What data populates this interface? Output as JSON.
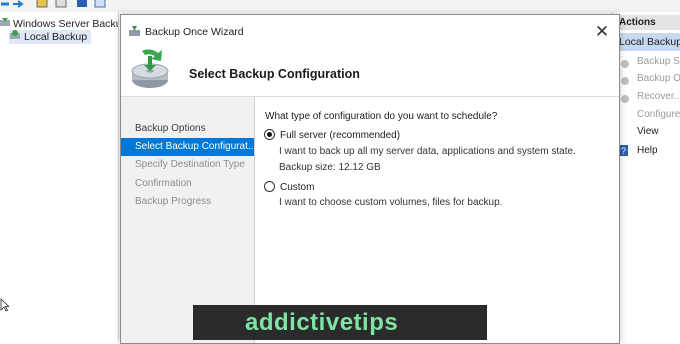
{
  "mmc": {
    "tree": {
      "root_label": "Windows Server Backup (L",
      "child_label": "Local Backup"
    },
    "actions_pane": {
      "header": "Actions",
      "section": "Local Backup",
      "items": [
        {
          "label": "Backup Sche",
          "icon": "backup-schedule-icon",
          "enabled": false
        },
        {
          "label": "Backup Onc",
          "icon": "backup-once-icon",
          "enabled": false
        },
        {
          "label": "Recover...",
          "icon": "recover-icon",
          "enabled": false
        },
        {
          "label": "Configure P",
          "icon": "",
          "enabled": false
        },
        {
          "label": "View",
          "icon": "",
          "enabled": true
        },
        {
          "label": "Help",
          "icon": "help-icon",
          "enabled": true
        }
      ]
    }
  },
  "wizard": {
    "title": "Backup Once Wizard",
    "close_glyph": "✕",
    "header_title": "Select Backup Configuration",
    "steps": [
      {
        "label": "Backup Options",
        "state": "done"
      },
      {
        "label": "Select Backup Configurat...",
        "state": "current"
      },
      {
        "label": "Specify Destination Type",
        "state": "pending"
      },
      {
        "label": "Confirmation",
        "state": "pending"
      },
      {
        "label": "Backup Progress",
        "state": "pending"
      }
    ],
    "question": "What type of configuration do you want to schedule?",
    "options": {
      "full": {
        "label": "Full server (recommended)",
        "checked": true,
        "description": "I want to back up all my server data, applications and system state.",
        "size": "Backup size: 12.12 GB"
      },
      "custom": {
        "label": "Custom",
        "checked": false,
        "description": "I want to choose custom volumes, files for backup."
      }
    }
  },
  "watermark": {
    "text": "addictivetips",
    "color": "#7fe3a3"
  }
}
